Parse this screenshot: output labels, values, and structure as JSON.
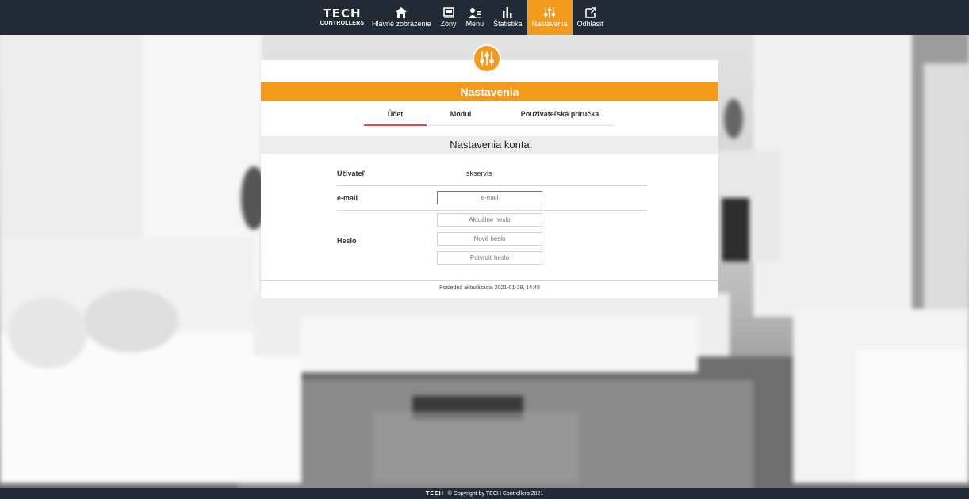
{
  "brand": {
    "logo_text": "TECH",
    "logo_subtext": "CONTROLLERS",
    "accent_color": "#f39a1a",
    "navbar_color": "#222a36",
    "error_color": "#e04a4a"
  },
  "nav": {
    "items": [
      {
        "label": "Hlavné zobrazenie",
        "icon": "home-icon"
      },
      {
        "label": "Zóny",
        "icon": "zones-icon"
      },
      {
        "label": "Menu",
        "icon": "menu-user-icon"
      },
      {
        "label": "Štatistika",
        "icon": "statistics-icon"
      },
      {
        "label": "Nastavenia",
        "icon": "settings-sliders-icon",
        "active": true
      },
      {
        "label": "Odhlásiť",
        "icon": "logout-icon"
      }
    ]
  },
  "panel": {
    "title": "Nastavenia",
    "tabs": [
      {
        "label": "Účet",
        "active": true
      },
      {
        "label": "Modul"
      },
      {
        "label": "Používateľská príručka"
      }
    ],
    "section_title": "Nastavenia konta",
    "user_label": "Užívateľ",
    "user_value": "skservis",
    "email_label": "e-mail",
    "email_placeholder": "e-mail",
    "password_label": "Heslo",
    "current_password_placeholder": "Aktuálne heslo",
    "new_password_placeholder": "Nové heslo",
    "confirm_password_placeholder": "Potvrdiť heslo",
    "last_update": "Posledná aktualizácia 2021-01-28, 14:48"
  },
  "footer": {
    "logo_text": "TECH",
    "copyright": "© Copyright by TECH Controllers 2021"
  }
}
